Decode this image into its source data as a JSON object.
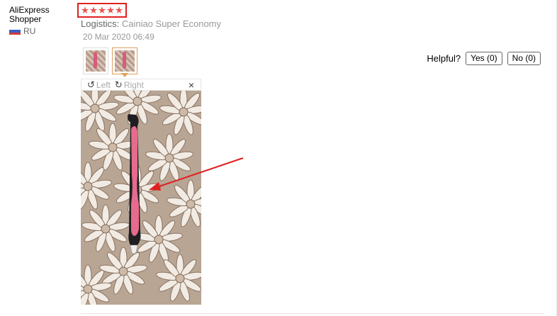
{
  "reviewer": {
    "name": "AliExpress Shopper",
    "country": "RU"
  },
  "review": {
    "rating": 5,
    "rating_max": 5,
    "logistics_label": "Logistics:",
    "logistics_value": "Cainiao Super Economy",
    "date": "20 Mar 2020 06:49"
  },
  "helpful": {
    "label": "Helpful?",
    "yes_label": "Yes (0)",
    "no_label": "No (0)"
  },
  "viewer": {
    "rotate_left": "Left",
    "rotate_right": "Right",
    "close": "×"
  },
  "icons": {
    "rotate_left": "rotate-left-icon",
    "rotate_right": "rotate-right-icon",
    "close": "close-icon",
    "star": "star-icon",
    "flag": "russia-flag-icon"
  },
  "colors": {
    "star": "#e8554e",
    "highlight": "#e02020",
    "thumb_selected": "#e0a060",
    "pen_grip": "#e66b8c"
  }
}
